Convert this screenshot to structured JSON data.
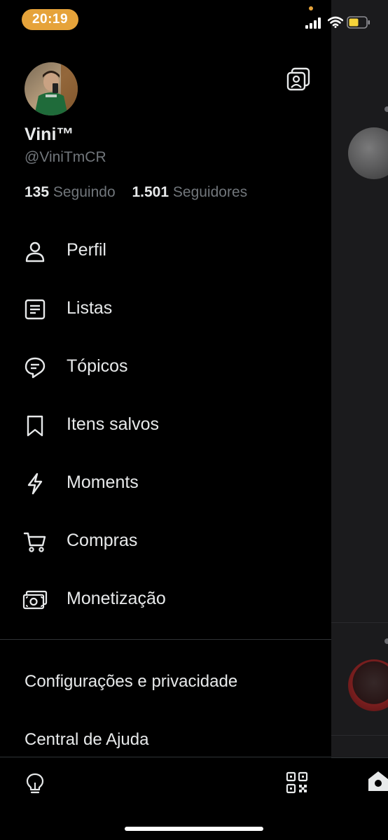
{
  "status_bar": {
    "time": "20:19",
    "accent_color": "#e6a33a"
  },
  "profile": {
    "display_name": "Vini™",
    "handle": "@ViniTmCR",
    "following_count": "135",
    "following_label": "Seguindo",
    "followers_count": "1.501",
    "followers_label": "Seguidores"
  },
  "menu": {
    "items": [
      {
        "label": "Perfil",
        "icon": "person-icon"
      },
      {
        "label": "Listas",
        "icon": "list-icon"
      },
      {
        "label": "Tópicos",
        "icon": "topics-icon"
      },
      {
        "label": "Itens salvos",
        "icon": "bookmark-icon"
      },
      {
        "label": "Moments",
        "icon": "lightning-icon"
      },
      {
        "label": "Compras",
        "icon": "cart-icon"
      },
      {
        "label": "Monetização",
        "icon": "money-icon"
      }
    ]
  },
  "secondary": {
    "settings": "Configurações e privacidade",
    "help": "Central de Ajuda"
  },
  "colors": {
    "background": "#000000",
    "text": "#e7e9ea",
    "muted": "#71767b",
    "divider": "#2f3336"
  }
}
